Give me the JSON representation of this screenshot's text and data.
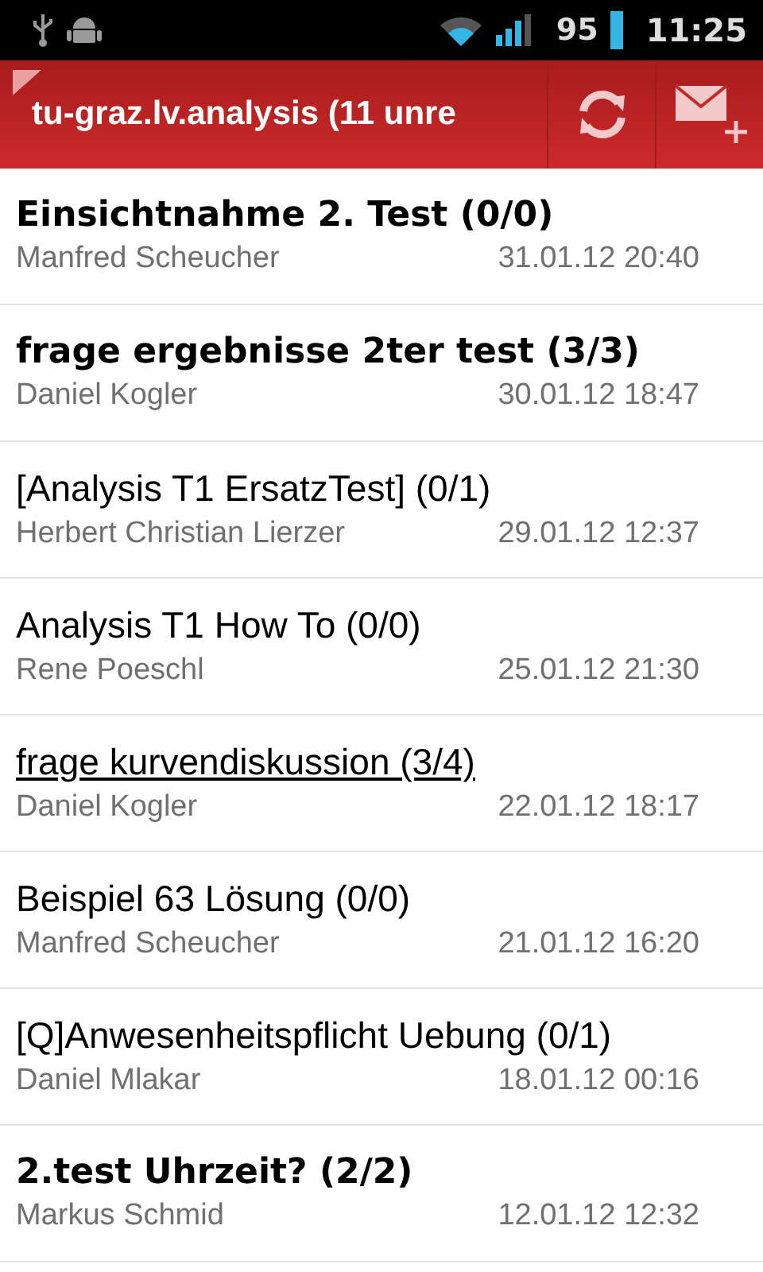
{
  "status_bar": {
    "battery": "95",
    "time": "11:25"
  },
  "header": {
    "title": "tu-graz.lv.analysis (11 unre"
  },
  "threads": [
    {
      "subject": "Einsichtnahme 2. Test (0/0)",
      "author": "Manfred Scheucher",
      "date": "31.01.12 20:40",
      "unread": true,
      "focused": false
    },
    {
      "subject": "frage ergebnisse 2ter test (3/3)",
      "author": "Daniel Kogler",
      "date": "30.01.12 18:47",
      "unread": true,
      "focused": false
    },
    {
      "subject": "[Analysis T1 ErsatzTest] (0/1)",
      "author": "Herbert Christian Lierzer",
      "date": "29.01.12 12:37",
      "unread": false,
      "focused": false
    },
    {
      "subject": "Analysis T1 How To (0/0)",
      "author": "Rene Poeschl",
      "date": "25.01.12 21:30",
      "unread": false,
      "focused": false
    },
    {
      "subject": "frage kurvendiskussion (3/4)",
      "author": "Daniel Kogler",
      "date": "22.01.12 18:17",
      "unread": false,
      "focused": true
    },
    {
      "subject": "Beispiel 63 Lösung (0/0)",
      "author": "Manfred Scheucher",
      "date": "21.01.12 16:20",
      "unread": false,
      "focused": false
    },
    {
      "subject": "[Q]Anwesenheitspflicht Uebung (0/1)",
      "author": "Daniel Mlakar",
      "date": "18.01.12 00:16",
      "unread": false,
      "focused": false
    },
    {
      "subject": "2.test Uhrzeit? (2/2)",
      "author": "Markus Schmid",
      "date": "12.01.12 12:32",
      "unread": true,
      "focused": false
    }
  ]
}
